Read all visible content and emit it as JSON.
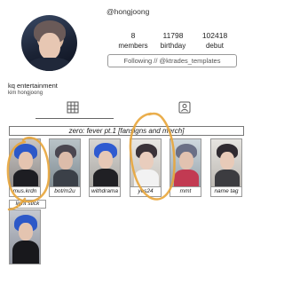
{
  "profile": {
    "username": "@hongjoong",
    "stats": [
      {
        "value": "8",
        "label": "members"
      },
      {
        "value": "11798",
        "label": "birthday"
      },
      {
        "value": "102418",
        "label": "debut"
      }
    ],
    "follow_label": "Following // @ktrades_templates",
    "bio_name": "kq entertainment",
    "bio_sub": "kim hongjoong"
  },
  "tabs": {
    "grid_icon": "grid-icon",
    "tagged_icon": "tagged-person-icon"
  },
  "section": {
    "title": "zero: fever pt.1 [fansigns and merch]"
  },
  "cards": [
    {
      "label": "mus.krdn"
    },
    {
      "label": "bot/m2u"
    },
    {
      "label": "withdrama"
    },
    {
      "label": "yes24"
    },
    {
      "label": "mmt"
    },
    {
      "label": "name tag"
    }
  ],
  "row2": {
    "label": "light stick"
  },
  "colors": {
    "annotation_circle": "#e8a53a",
    "border": "#999999"
  }
}
